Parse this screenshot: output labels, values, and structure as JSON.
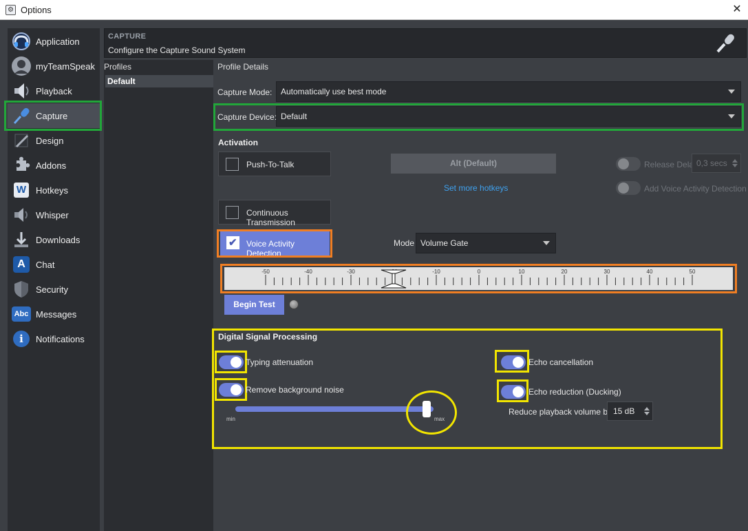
{
  "window": {
    "title": "Options",
    "close_symbol": "✕"
  },
  "nav": {
    "items": [
      {
        "label": "Application",
        "icon": "teamspeak-logo-icon"
      },
      {
        "label": "myTeamSpeak",
        "icon": "user-avatar-icon"
      },
      {
        "label": "Playback",
        "icon": "speaker-icon"
      },
      {
        "label": "Capture",
        "icon": "microphone-icon",
        "active": true
      },
      {
        "label": "Design",
        "icon": "brush-icon"
      },
      {
        "label": "Addons",
        "icon": "puzzle-icon"
      },
      {
        "label": "Hotkeys",
        "icon": "w-key-icon",
        "glyph": "W"
      },
      {
        "label": "Whisper",
        "icon": "whisper-speaker-icon"
      },
      {
        "label": "Downloads",
        "icon": "download-arrow-icon"
      },
      {
        "label": "Chat",
        "icon": "chat-a-icon",
        "glyph": "A"
      },
      {
        "label": "Security",
        "icon": "shield-icon"
      },
      {
        "label": "Messages",
        "icon": "abc-message-icon",
        "glyph": "Abc"
      },
      {
        "label": "Notifications",
        "icon": "info-icon",
        "glyph": "i"
      }
    ]
  },
  "header": {
    "title": "CAPTURE",
    "subtitle": "Configure the Capture Sound System"
  },
  "profiles": {
    "heading": "Profiles",
    "items": [
      "Default"
    ]
  },
  "details": {
    "heading": "Profile Details",
    "capture_mode_label": "Capture Mode:",
    "capture_mode_value": "Automatically use best mode",
    "capture_device_label": "Capture Device:",
    "capture_device_value": "Default"
  },
  "activation": {
    "heading": "Activation",
    "push_to_talk_label": "Push-To-Talk",
    "push_to_talk_checked": false,
    "hotkey_button_label": "Alt (Default)",
    "set_hotkeys_link": "Set more hotkeys",
    "release_delay_label": "Release Delay",
    "release_delay_value": "0,3 secs",
    "add_vad_label": "Add Voice Activity Detection",
    "continuous_label": "Continuous Transmission",
    "continuous_checked": false,
    "vad_label": "Voice Activity Detection",
    "vad_checked": true,
    "vad_check_symbol": "✔",
    "mode_label": "Mode",
    "mode_value": "Volume Gate"
  },
  "meter": {
    "tick_labels": [
      "-50",
      "-40",
      "-30",
      "-20",
      "-10",
      "0",
      "10",
      "20",
      "30",
      "40",
      "50"
    ],
    "threshold_value": -20
  },
  "test": {
    "begin_label": "Begin Test"
  },
  "dsp": {
    "heading": "Digital Signal Processing",
    "typing_attenuation_label": "Typing attenuation",
    "typing_attenuation_on": true,
    "remove_noise_label": "Remove background noise",
    "remove_noise_on": true,
    "noise_slider_min_label": "min",
    "noise_slider_max_label": "max",
    "noise_slider_fraction": 0.95,
    "echo_cancellation_label": "Echo cancellation",
    "echo_cancellation_on": true,
    "echo_reduction_label": "Echo reduction (Ducking)",
    "echo_reduction_on": true,
    "reduce_volume_label": "Reduce playback volume by:",
    "reduce_volume_value": "15 dB"
  },
  "colors": {
    "accent": "#6d7fd8",
    "link": "#3fa2f0",
    "highlight_green": "#22a63a",
    "highlight_orange": "#f07e23",
    "highlight_yellow": "#f2e500"
  }
}
